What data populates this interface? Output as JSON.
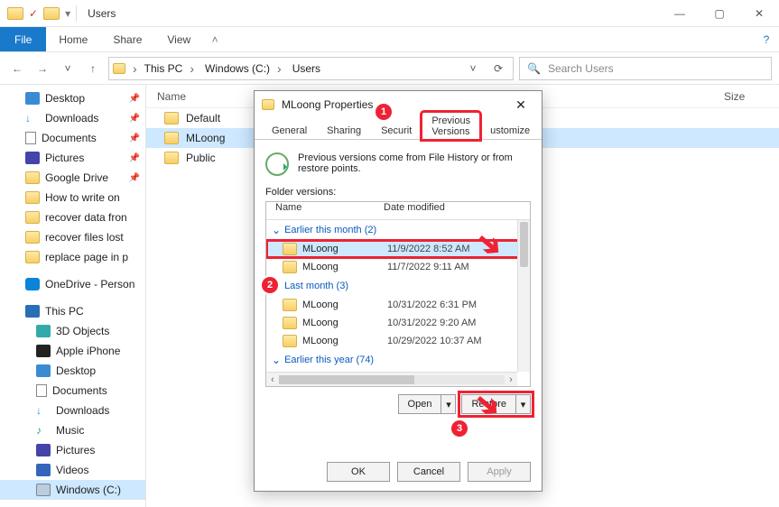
{
  "window": {
    "title": "Users",
    "controls": {
      "min": "—",
      "max": "▢",
      "close": "✕"
    }
  },
  "ribbon": {
    "file": "File",
    "home": "Home",
    "share": "Share",
    "view": "View",
    "chev": "˄",
    "help": "?"
  },
  "nav": {
    "back": "←",
    "fwd": "→",
    "recent": "˅",
    "up": "↑",
    "crumbs": [
      "This PC",
      "Windows (C:)",
      "Users"
    ],
    "dd": "˅",
    "refresh": "⟳",
    "search_icon": "🔍",
    "search_placeholder": "Search Users"
  },
  "tree": {
    "quick": [
      {
        "label": "Desktop",
        "icon": "ico-desktop",
        "pin": true
      },
      {
        "label": "Downloads",
        "icon": "ico-down",
        "pin": true
      },
      {
        "label": "Documents",
        "icon": "ico-doc",
        "pin": true
      },
      {
        "label": "Pictures",
        "icon": "ico-pic",
        "pin": true
      },
      {
        "label": "Google Drive",
        "icon": "ico-fld",
        "pin": true
      },
      {
        "label": "How to write on",
        "icon": "ico-fld"
      },
      {
        "label": "recover data fron",
        "icon": "ico-fld"
      },
      {
        "label": "recover files lost",
        "icon": "ico-fld"
      },
      {
        "label": "replace page in p",
        "icon": "ico-fld"
      }
    ],
    "onedrive": {
      "label": "OneDrive - Person",
      "icon": "ico-od"
    },
    "thispc_label": "This PC",
    "thispc": [
      {
        "label": "3D Objects",
        "icon": "ico-3d"
      },
      {
        "label": "Apple iPhone",
        "icon": "ico-ip"
      },
      {
        "label": "Desktop",
        "icon": "ico-desktop"
      },
      {
        "label": "Documents",
        "icon": "ico-doc"
      },
      {
        "label": "Downloads",
        "icon": "ico-down"
      },
      {
        "label": "Music",
        "icon": "ico-mus"
      },
      {
        "label": "Pictures",
        "icon": "ico-pic"
      },
      {
        "label": "Videos",
        "icon": "ico-vid"
      },
      {
        "label": "Windows (C:)",
        "icon": "ico-drv",
        "sel": true
      }
    ]
  },
  "columns": {
    "name": "Name",
    "date": "",
    "size": "Size"
  },
  "files": [
    {
      "name": "Default"
    },
    {
      "name": "MLoong",
      "sel": true
    },
    {
      "name": "Public"
    }
  ],
  "dialog": {
    "title": "MLoong Properties",
    "close": "✕",
    "tabs": [
      "General",
      "Sharing",
      "Securit",
      "Previous Versions",
      "ustomize"
    ],
    "active_tab_index": 3,
    "info": "Previous versions come from File History or from restore points.",
    "versions_label": "Folder versions:",
    "head": {
      "name": "Name",
      "date": "Date modified"
    },
    "groups": [
      {
        "title": "Earlier this month (2)",
        "rows": [
          {
            "name": "MLoong",
            "date": "11/9/2022 8:52 AM",
            "sel": true
          },
          {
            "name": "MLoong",
            "date": "11/7/2022 9:11 AM"
          }
        ]
      },
      {
        "title": "Last month (3)",
        "rows": [
          {
            "name": "MLoong",
            "date": "10/31/2022 6:31 PM"
          },
          {
            "name": "MLoong",
            "date": "10/31/2022 9:20 AM"
          },
          {
            "name": "MLoong",
            "date": "10/29/2022 10:37 AM"
          }
        ]
      },
      {
        "title": "Earlier this year (74)",
        "rows": []
      }
    ],
    "hscroll": {
      "left": "‹",
      "right": "›"
    },
    "actions": {
      "open": "Open",
      "open_dd": "▾",
      "restore": "Restore",
      "restore_dd": "▾"
    },
    "footer": {
      "ok": "OK",
      "cancel": "Cancel",
      "apply": "Apply"
    }
  },
  "badges": {
    "1": "1",
    "2": "2",
    "3": "3"
  }
}
